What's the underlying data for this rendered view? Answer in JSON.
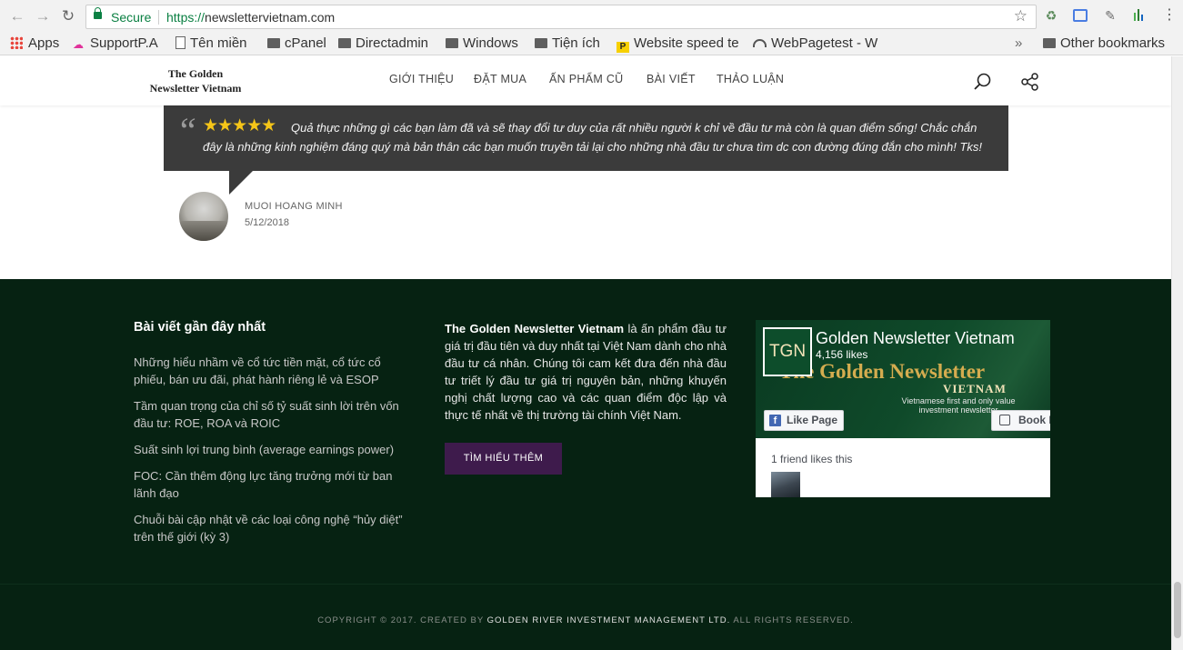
{
  "browser": {
    "secure_label": "Secure",
    "url_protocol": "https://",
    "url_host": "newslettervietnam.com",
    "bookmarks": [
      {
        "label": "Apps",
        "icon": "apps-grid-icon"
      },
      {
        "label": "SupportP.A",
        "icon": "support-icon"
      },
      {
        "label": "Tên miền",
        "icon": "page-icon"
      },
      {
        "label": "cPanel",
        "icon": "folder-icon"
      },
      {
        "label": "Directadmin",
        "icon": "folder-icon"
      },
      {
        "label": "Windows",
        "icon": "folder-icon"
      },
      {
        "label": "Tiện ích",
        "icon": "folder-icon"
      },
      {
        "label": "Website speed te",
        "icon": "pagespeed-icon"
      },
      {
        "label": "WebPagetest - W",
        "icon": "gauge-icon"
      }
    ],
    "overflow_label": "»",
    "other_bookmarks": "Other bookmarks"
  },
  "site": {
    "logo_line1": "The Golden",
    "logo_line2": "Newsletter Vietnam",
    "menu": [
      "GIỚI THIỆU",
      "ĐẶT MUA",
      "ẤN PHẨM CŨ",
      "BÀI VIẾT",
      "THẢO LUẬN"
    ]
  },
  "testimonial": {
    "rating": 5,
    "stars": "★★★★★",
    "text": "Quả thực những gì các bạn làm đã và sẽ thay đổi tư duy của rất nhiều người k chỉ về đầu tư mà còn là quan điểm sống! Chắc chắn đây là những kinh nghiệm đáng quý mà bản thân các bạn muốn truyền tải lại cho những nhà đầu tư chưa tìm dc con đường đúng đắn cho mình! Tks!",
    "author": "MUOI HOANG MINH",
    "date": "5/12/2018"
  },
  "footer": {
    "recent_title": "Bài viết gần đây nhất",
    "recent_posts": [
      "Những hiểu nhầm về cổ tức tiền mặt, cổ tức cổ phiếu, bán ưu đãi, phát hành riêng lẻ và ESOP",
      "Tầm quan trọng của chỉ số tỷ suất sinh lời trên vốn đầu tư: ROE, ROA và ROIC",
      "Suất sinh lợi trung bình (average earnings power)",
      "FOC: Cần thêm động lực tăng trưởng mới từ ban lãnh đạo",
      "Chuỗi bài cập nhật về các loại công nghệ “hủy diệt” trên thế giới (kỳ 3)"
    ],
    "about_brand": "The Golden Newsletter Vietnam",
    "about_text": " là ấn phẩm đầu tư giá trị đầu tiên và duy nhất tại Việt Nam dành cho nhà đầu tư cá nhân. Chúng tôi cam kết đưa đến nhà đầu tư triết lý đầu tư giá trị nguyên bản, những khuyến nghị chất lượng cao và các quan điểm độc lập và thực tế nhất về thị trường tài chính Việt Nam.",
    "learn_more": "TÌM HIỂU THÊM",
    "facebook": {
      "logo_text": "TGN",
      "page_name": "Golden Newsletter Vietnam",
      "likes": "4,156 likes",
      "cover_title": "The Golden Newsletter",
      "cover_sub": "VIETNAM",
      "cover_tag": "Vietnamese first and only value investment newsletter",
      "like_button": "Like Page",
      "book_button": "Book N",
      "friends_text": "1 friend likes this"
    },
    "copyright_prefix": "COPYRIGHT © 2017. CREATED BY ",
    "copyright_company": "GOLDEN RIVER INVESTMENT MANAGEMENT LTD.",
    "copyright_suffix": " ALL RIGHTS RESERVED."
  },
  "colors": {
    "footer_bg": "#062212",
    "testimonial_bg": "#3b3b3b",
    "button_bg": "#3e1b4c",
    "star": "#f5c518",
    "secure_green": "#0b8043"
  }
}
